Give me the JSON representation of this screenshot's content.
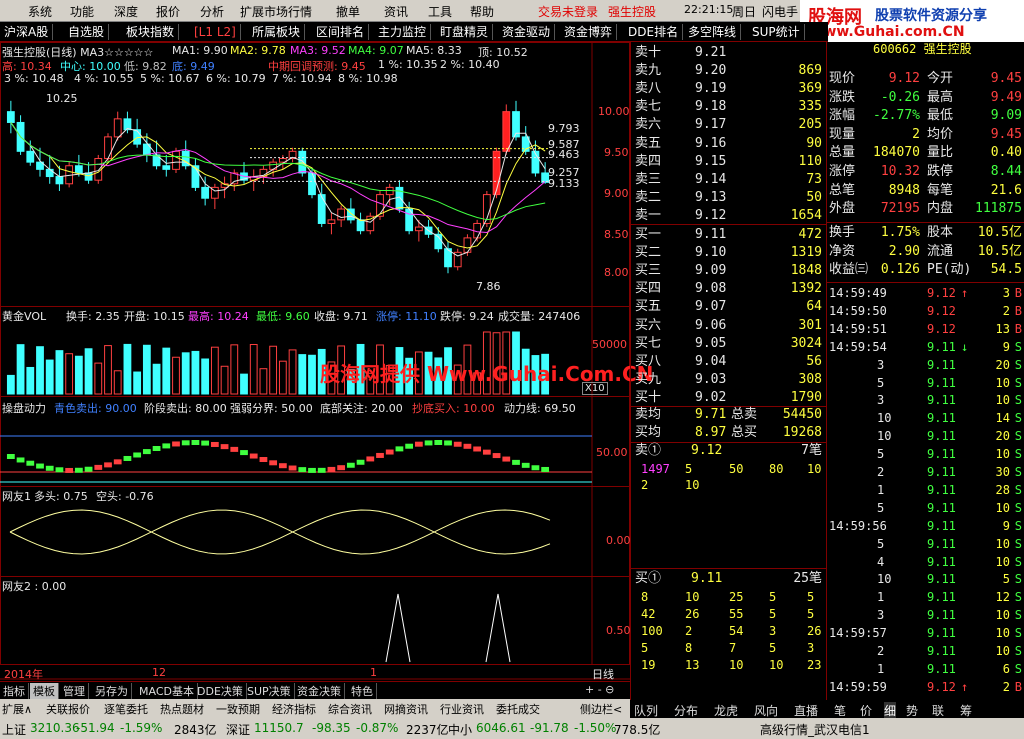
{
  "menu": {
    "items": [
      "系统",
      "功能",
      "深度",
      "报价",
      "分析",
      "扩展市场行情",
      "撤单",
      "资讯",
      "工具",
      "帮助"
    ],
    "trade_status": "交易未登录",
    "stock_label": "强生控股",
    "clock": "22:21:15",
    "weekday": "周日",
    "flash_btn": "闪电手"
  },
  "logo": {
    "brand": "股海网",
    "tagline": "股票软件资源分享",
    "url": "Www.Guhai.com.CN"
  },
  "tabs": [
    "沪深A股",
    "自选股",
    "板块指数",
    "[L1 L2]",
    "所属板块",
    "区间排名",
    "主力监控",
    "盯盘精灵",
    "资金驱动",
    "资金博弈",
    "DDE排名",
    "多空阵线",
    "SUP统计"
  ],
  "main_chart": {
    "header": "强生控股(日线) MA3☆☆☆☆☆",
    "ma": [
      {
        "label": "MA1: 9.90",
        "color": "#e8e8e8"
      },
      {
        "label": "MA2: 9.78",
        "color": "#ffff40"
      },
      {
        "label": "MA3: 9.52",
        "color": "#ff40ff"
      },
      {
        "label": "MA4: 9.07",
        "color": "#40ff40"
      },
      {
        "label": "MA5: 8.33",
        "color": "#e8e8e8"
      }
    ],
    "top_label": "顶: 10.52",
    "line2": {
      "high": "高: 10.34",
      "center": "中心: 10.00",
      "low": "低: 9.82",
      "bottom": "底: 9.49",
      "forecast": "中期回调预测: 9.45",
      "p1": "1 %: 10.35",
      "p2": "2 %: 10.40"
    },
    "line3": [
      "3 %: 10.48",
      "4 %: 10.55",
      "5 %: 10.67",
      "6 %: 10.79",
      "7 %: 10.94",
      "8 %: 10.98"
    ],
    "price_axis": [
      "10.00",
      "9.50",
      "9.00",
      "8.50",
      "8.00"
    ],
    "annotations": {
      "high_mark": "10.25",
      "low_mark": "7.86"
    },
    "levels": [
      "9.793",
      "9.587",
      "9.463",
      "9.257",
      "9.133"
    ]
  },
  "vol_chart": {
    "header": "黄金VOL",
    "turnover": "换手: 2.35",
    "open": "开盘: 10.15",
    "high": "最高: 10.24",
    "low": "最低: 9.60",
    "close": "收盘: 9.71",
    "limit_up": "涨停: 11.10",
    "limit_down": "跌停: 9.24",
    "volume": "成交量: 247406",
    "axis": [
      "50000",
      "X10"
    ]
  },
  "watermark": "股海网提供 Www.Guhai.Com.CN",
  "power_chart": {
    "header": "操盘动力",
    "a": "青色卖出: 90.00",
    "b": "阶段卖出: 80.00",
    "c": "强弱分界: 50.00",
    "d": "底部关注: 20.00",
    "e": "抄底买入: 10.00",
    "f": "动力线: 69.50",
    "axis": "50.00"
  },
  "friend1": {
    "header": "网友1",
    "long": "多头: 0.75",
    "short": "空头: -0.76",
    "axis": "0.00"
  },
  "friend2": {
    "header": "网友2 : 0.00",
    "axis": "0.50"
  },
  "time_axis": {
    "year": "2014年",
    "month": "12",
    "m1": "1",
    "period": "日线"
  },
  "bottom_tabs": [
    "指标",
    "模板",
    "管理",
    "另存为",
    "MACD基本",
    "DDE决策",
    "SUP决策",
    "资金决策",
    "特色"
  ],
  "nav_row": [
    "扩展∧",
    "关联报价",
    "逐笔委托",
    "热点题材",
    "一致预期",
    "经济指标",
    "综合资讯",
    "网摘资讯",
    "行业资讯",
    "委托成交",
    "侧边栏<"
  ],
  "order_book": {
    "sell": [
      {
        "label": "卖十",
        "price": "9.21",
        "vol": ""
      },
      {
        "label": "卖九",
        "price": "9.20",
        "vol": "869"
      },
      {
        "label": "卖八",
        "price": "9.19",
        "vol": "369"
      },
      {
        "label": "卖七",
        "price": "9.18",
        "vol": "335"
      },
      {
        "label": "卖六",
        "price": "9.17",
        "vol": "205"
      },
      {
        "label": "卖五",
        "price": "9.16",
        "vol": "90"
      },
      {
        "label": "卖四",
        "price": "9.15",
        "vol": "110"
      },
      {
        "label": "卖三",
        "price": "9.14",
        "vol": "73"
      },
      {
        "label": "卖二",
        "price": "9.13",
        "vol": "50"
      },
      {
        "label": "卖一",
        "price": "9.12",
        "vol": "1654"
      }
    ],
    "buy": [
      {
        "label": "买一",
        "price": "9.11",
        "vol": "472"
      },
      {
        "label": "买二",
        "price": "9.10",
        "vol": "1319"
      },
      {
        "label": "买三",
        "price": "9.09",
        "vol": "1848"
      },
      {
        "label": "买四",
        "price": "9.08",
        "vol": "1392"
      },
      {
        "label": "买五",
        "price": "9.07",
        "vol": "64"
      },
      {
        "label": "买六",
        "price": "9.06",
        "vol": "301"
      },
      {
        "label": "买七",
        "price": "9.05",
        "vol": "3024"
      },
      {
        "label": "买八",
        "price": "9.04",
        "vol": "56"
      },
      {
        "label": "买九",
        "price": "9.03",
        "vol": "308"
      },
      {
        "label": "买十",
        "price": "9.02",
        "vol": "1790"
      }
    ],
    "avg_sell_label": "卖均",
    "avg_sell": "9.71",
    "total_sell_label": "总卖",
    "total_sell": "54450",
    "avg_buy_label": "买均",
    "avg_buy": "8.97",
    "total_buy_label": "总买",
    "total_buy": "19268",
    "s1_label": "卖①",
    "s1_price": "9.12",
    "s1_count": "7笔",
    "s1_rows": [
      [
        "1497",
        "5",
        "50",
        "80",
        "10"
      ],
      [
        "2",
        "10",
        "",
        "",
        ""
      ]
    ],
    "b1_label": "买①",
    "b1_price": "9.11",
    "b1_count": "25笔",
    "b1_rows": [
      [
        "8",
        "10",
        "25",
        "5",
        "5"
      ],
      [
        "42",
        "26",
        "55",
        "5",
        "5"
      ],
      [
        "100",
        "2",
        "54",
        "3",
        "26"
      ],
      [
        "5",
        "8",
        "7",
        "5",
        "3"
      ],
      [
        "19",
        "13",
        "10",
        "10",
        "23"
      ]
    ]
  },
  "quote": {
    "code_name": "600662 强生控股",
    "rows": [
      [
        "现价",
        "9.12",
        "今开",
        "9.45"
      ],
      [
        "涨跌",
        "-0.26",
        "最高",
        "9.49"
      ],
      [
        "涨幅",
        "-2.77%",
        "最低",
        "9.09"
      ],
      [
        "现量",
        "2",
        "均价",
        "9.45"
      ],
      [
        "总量",
        "184070",
        "量比",
        "0.40"
      ],
      [
        "涨停",
        "10.32",
        "跌停",
        "8.44"
      ],
      [
        "总笔",
        "8948",
        "每笔",
        "21.6"
      ],
      [
        "外盘",
        "72195",
        "内盘",
        "111875"
      ]
    ],
    "rows2": [
      [
        "换手",
        "1.75%",
        "股本",
        "10.5亿"
      ],
      [
        "净资",
        "2.90",
        "流通",
        "10.5亿"
      ],
      [
        "收益㈢",
        "0.126",
        "PE(动)",
        "54.5"
      ]
    ]
  },
  "ticks": [
    [
      "14:59:49",
      "9.12",
      "↑",
      "3",
      "B"
    ],
    [
      "14:59:50",
      "9.12",
      "",
      "2",
      "B"
    ],
    [
      "14:59:51",
      "9.12",
      "",
      "13",
      "B"
    ],
    [
      "14:59:54",
      "9.11",
      "↓",
      "9",
      "S"
    ],
    [
      "3",
      "9.11",
      "",
      "20",
      "S"
    ],
    [
      "5",
      "9.11",
      "",
      "10",
      "S"
    ],
    [
      "3",
      "9.11",
      "",
      "10",
      "S"
    ],
    [
      "10",
      "9.11",
      "",
      "14",
      "S"
    ],
    [
      "10",
      "9.11",
      "",
      "20",
      "S"
    ],
    [
      "5",
      "9.11",
      "",
      "10",
      "S"
    ],
    [
      "2",
      "9.11",
      "",
      "30",
      "S"
    ],
    [
      "1",
      "9.11",
      "",
      "28",
      "S"
    ],
    [
      "5",
      "9.11",
      "",
      "10",
      "S"
    ],
    [
      "14:59:56",
      "9.11",
      "",
      "9",
      "S"
    ],
    [
      "5",
      "9.11",
      "",
      "10",
      "S"
    ],
    [
      "4",
      "9.11",
      "",
      "10",
      "S"
    ],
    [
      "10",
      "9.11",
      "",
      "5",
      "S"
    ],
    [
      "1",
      "9.11",
      "",
      "12",
      "S"
    ],
    [
      "3",
      "9.11",
      "",
      "10",
      "S"
    ],
    [
      "14:59:57",
      "9.11",
      "",
      "10",
      "S"
    ],
    [
      "2",
      "9.11",
      "",
      "10",
      "S"
    ],
    [
      "1",
      "9.11",
      "",
      "6",
      "S"
    ],
    [
      "14:59:59",
      "9.12",
      "↑",
      "2",
      "B"
    ]
  ],
  "right_tabs": [
    "队列",
    "分布",
    "龙虎",
    "风向",
    "直播",
    "笔",
    "价",
    "细",
    "势",
    "联",
    "筹"
  ],
  "status": {
    "sh_label": "上证",
    "sh_val": "3210.36",
    "sh_chg": "-51.94",
    "sh_pct": "-1.59%",
    "sh_amt": "2843亿",
    "sz_label": "深证",
    "sz_val": "11150.7",
    "sz_chg": "-98.35",
    "sz_pct": "-0.87%",
    "sz_amt": "2237亿",
    "sme_label": "中小",
    "sme_val": "6046.61",
    "sme_chg": "-91.78",
    "sme_pct": "-1.50%",
    "sme_amt": "778.5亿",
    "server": "高级行情_武汉电信1"
  },
  "chart_data": {
    "type": "candlestick",
    "price_range": [
      7.6,
      10.4
    ],
    "candles": [
      [
        10.1,
        10.25,
        9.8,
        9.95
      ],
      [
        9.95,
        10.05,
        9.5,
        9.55
      ],
      [
        9.55,
        9.7,
        9.35,
        9.4
      ],
      [
        9.4,
        9.6,
        9.2,
        9.3
      ],
      [
        9.3,
        9.5,
        9.1,
        9.2
      ],
      [
        9.2,
        9.35,
        9.0,
        9.1
      ],
      [
        9.1,
        9.4,
        9.05,
        9.35
      ],
      [
        9.35,
        9.5,
        9.2,
        9.25
      ],
      [
        9.25,
        9.4,
        9.1,
        9.15
      ],
      [
        9.15,
        9.5,
        9.1,
        9.45
      ],
      [
        9.45,
        9.8,
        9.4,
        9.75
      ],
      [
        9.75,
        10.1,
        9.7,
        10.0
      ],
      [
        10.0,
        10.1,
        9.8,
        9.85
      ],
      [
        9.85,
        10.0,
        9.6,
        9.65
      ],
      [
        9.65,
        9.8,
        9.4,
        9.5
      ],
      [
        9.5,
        9.7,
        9.3,
        9.35
      ],
      [
        9.35,
        9.5,
        9.2,
        9.3
      ],
      [
        9.3,
        9.6,
        9.25,
        9.55
      ],
      [
        9.55,
        9.7,
        9.3,
        9.35
      ],
      [
        9.35,
        9.45,
        9.0,
        9.05
      ],
      [
        9.05,
        9.2,
        8.8,
        8.9
      ],
      [
        8.9,
        9.1,
        8.75,
        9.05
      ],
      [
        9.05,
        9.2,
        8.9,
        9.1
      ],
      [
        9.1,
        9.3,
        9.0,
        9.25
      ],
      [
        9.25,
        9.4,
        9.1,
        9.15
      ],
      [
        9.15,
        9.3,
        9.0,
        9.2
      ],
      [
        9.2,
        9.35,
        9.1,
        9.3
      ],
      [
        9.3,
        9.45,
        9.2,
        9.4
      ],
      [
        9.4,
        9.5,
        9.3,
        9.45
      ],
      [
        9.45,
        9.6,
        9.4,
        9.55
      ],
      [
        9.55,
        9.6,
        9.2,
        9.25
      ],
      [
        9.25,
        9.3,
        8.9,
        8.95
      ],
      [
        8.95,
        9.1,
        8.5,
        8.55
      ],
      [
        8.55,
        8.7,
        8.4,
        8.6
      ],
      [
        8.6,
        8.8,
        8.5,
        8.75
      ],
      [
        8.75,
        8.9,
        8.55,
        8.6
      ],
      [
        8.6,
        8.7,
        8.4,
        8.45
      ],
      [
        8.45,
        8.7,
        8.4,
        8.65
      ],
      [
        8.65,
        9.0,
        8.6,
        8.95
      ],
      [
        8.95,
        9.1,
        8.8,
        9.05
      ],
      [
        9.05,
        9.15,
        8.7,
        8.75
      ],
      [
        8.75,
        8.85,
        8.4,
        8.45
      ],
      [
        8.45,
        8.6,
        8.3,
        8.5
      ],
      [
        8.5,
        8.6,
        8.35,
        8.4
      ],
      [
        8.4,
        8.5,
        8.15,
        8.2
      ],
      [
        8.2,
        8.3,
        7.86,
        7.95
      ],
      [
        7.95,
        8.2,
        7.9,
        8.15
      ],
      [
        8.15,
        8.4,
        8.1,
        8.35
      ],
      [
        8.35,
        8.6,
        8.3,
        8.55
      ],
      [
        8.55,
        9.0,
        8.5,
        8.95
      ],
      [
        8.95,
        9.6,
        8.9,
        9.55
      ],
      [
        9.55,
        10.2,
        9.5,
        10.1
      ],
      [
        10.1,
        10.25,
        9.7,
        9.75
      ],
      [
        9.75,
        9.9,
        9.5,
        9.55
      ],
      [
        9.55,
        9.7,
        9.2,
        9.25
      ],
      [
        9.25,
        9.4,
        9.1,
        9.12
      ]
    ]
  }
}
